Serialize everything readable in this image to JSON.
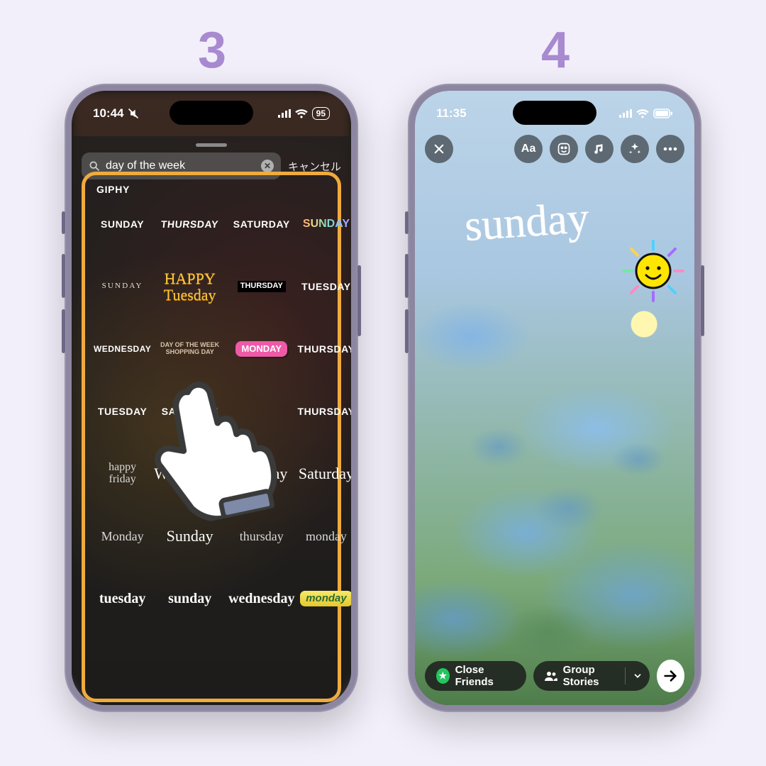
{
  "steps": {
    "left": "3",
    "right": "4"
  },
  "phone3": {
    "status": {
      "time": "10:44",
      "battery": "95"
    },
    "search": {
      "query": "day of the week",
      "cancel": "キャンセル"
    },
    "giphy_label": "GIPHY",
    "stickers": [
      "SUNDAY",
      "THURSDAY",
      "SATURDAY",
      "SUNDAY",
      "SUNDAY",
      "HAPPY Tuesday",
      "THURSDAY",
      "TUESDAY",
      "WEDNESDAY",
      "DAY OF THE WEEK SHOPPING DAY",
      "MONDAY",
      "THURSDAY",
      "TUESDAY",
      "SATURDAY",
      "",
      "THURSDAY",
      "happy friday",
      "Wednesday",
      "Monday",
      "Saturday",
      "Monday",
      "Sunday",
      "thursday",
      "monday",
      "tuesday",
      "sunday",
      "wednesday",
      "monday"
    ]
  },
  "phone4": {
    "status": {
      "time": "11:35"
    },
    "tools": {
      "text": "Aa"
    },
    "placed_sticker": "sunday",
    "bottom": {
      "close_friends": "Close Friends",
      "group_stories": "Group Stories"
    }
  }
}
